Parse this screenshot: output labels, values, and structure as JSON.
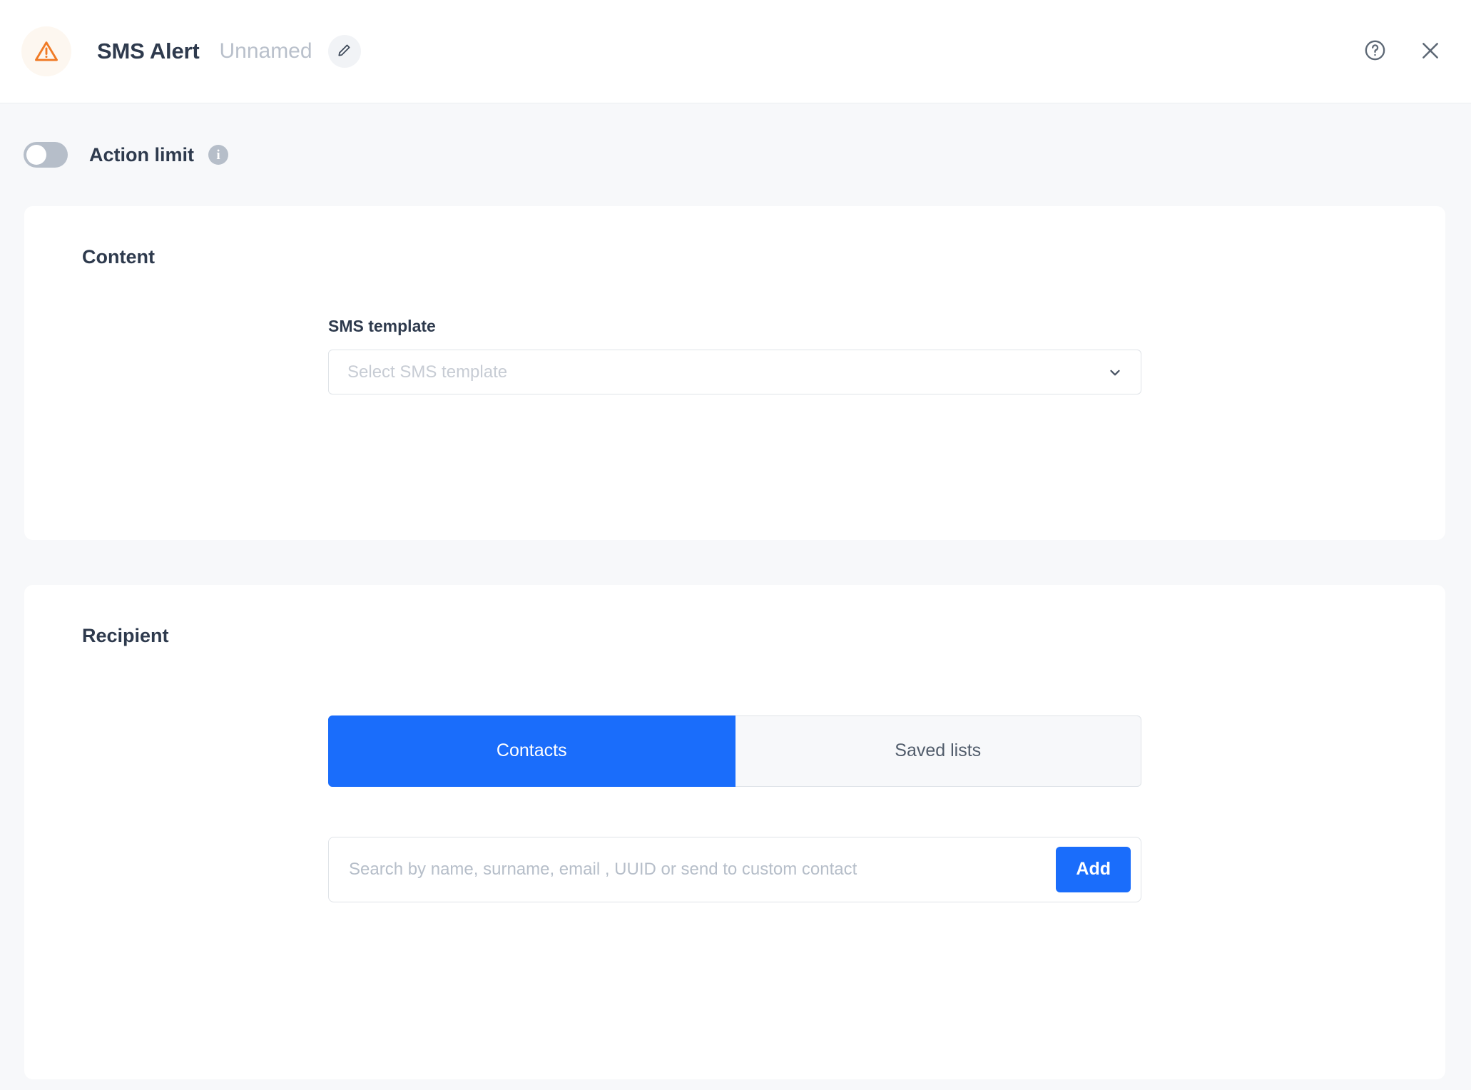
{
  "header": {
    "alert_icon": "warning-triangle-icon",
    "title": "SMS Alert",
    "subtitle": "Unnamed",
    "edit_icon": "pencil-icon",
    "help_icon": "help-circle-icon",
    "close_icon": "close-icon"
  },
  "action_limit": {
    "label": "Action limit",
    "enabled": false,
    "info_icon": "info-icon",
    "info_glyph": "i"
  },
  "content_section": {
    "title": "Content",
    "sms_template": {
      "label": "SMS template",
      "placeholder": "Select SMS template",
      "value": "",
      "chevron_icon": "chevron-down-icon"
    }
  },
  "recipient_section": {
    "title": "Recipient",
    "tabs": [
      {
        "label": "Contacts",
        "active": true
      },
      {
        "label": "Saved lists",
        "active": false
      }
    ],
    "search": {
      "placeholder": "Search by name, surname, email , UUID or send to custom contact",
      "value": "",
      "add_label": "Add"
    }
  },
  "colors": {
    "accent_blue": "#1a6dfb",
    "alert_orange": "#f07a25",
    "page_background": "#f7f8fa",
    "card_background": "#ffffff",
    "text_primary": "#2e3a4d",
    "text_muted": "#b6bec9",
    "border": "#dfe3e8"
  }
}
